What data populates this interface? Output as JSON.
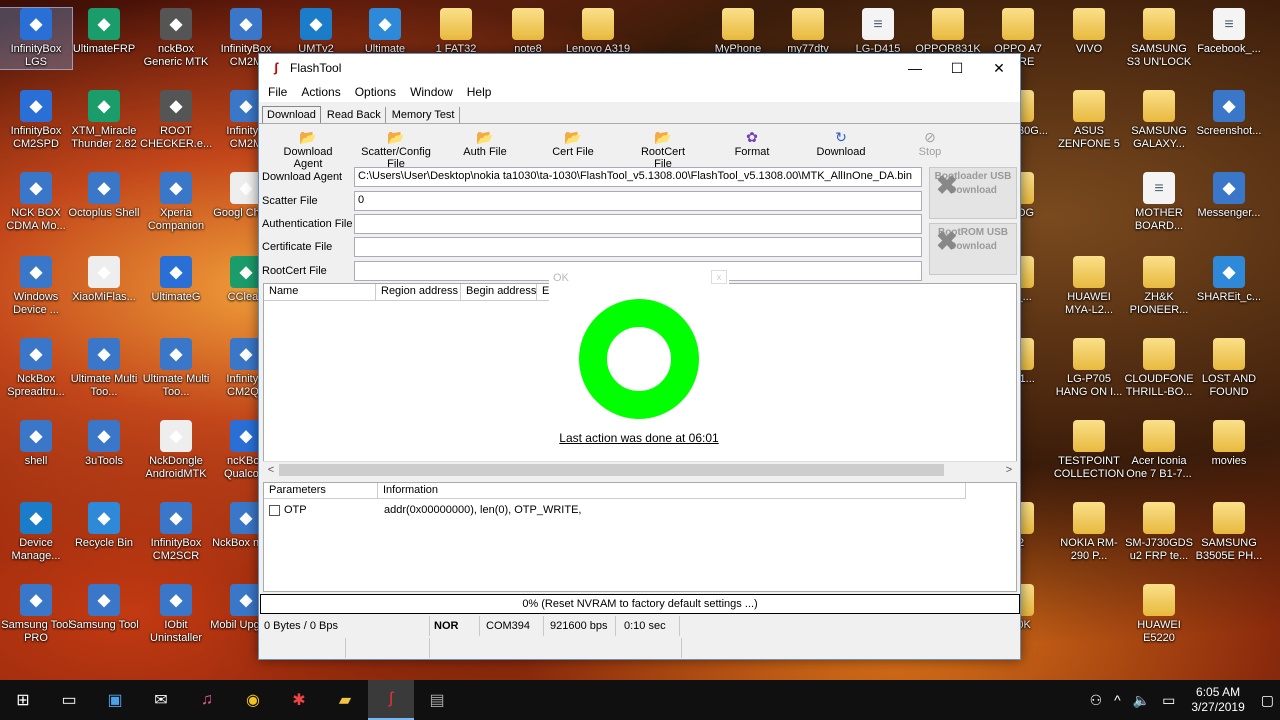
{
  "desktop": {
    "icons": [
      {
        "label": "InfinityBox LGS",
        "icon": "infinitybox-icon"
      },
      {
        "label": "UltimateFRP",
        "icon": "ultimate-frp-icon"
      },
      {
        "label": "nckBox Generic MTK",
        "icon": "nckbox-icon"
      },
      {
        "label": "InfinityBox CM2M",
        "icon": "infinitybox-icon"
      },
      {
        "label": "UMTv2",
        "icon": "umt-icon"
      },
      {
        "label": "Ultimate",
        "icon": "ultimate-icon"
      },
      {
        "label": "1 FAT32",
        "icon": "folder-icon"
      },
      {
        "label": "note8",
        "icon": "folder-icon"
      },
      {
        "label": "Lenovo A319",
        "icon": "folder-icon"
      },
      {
        "label": "MyPhone",
        "icon": "folder-icon"
      },
      {
        "label": "my77dtv",
        "icon": "folder-icon"
      },
      {
        "label": "LG-D415",
        "icon": "file-icon"
      },
      {
        "label": "OPPOR831K",
        "icon": "folder-icon"
      },
      {
        "label": "OPPO A7 WARE",
        "icon": "folder-icon"
      },
      {
        "label": "VIVO",
        "icon": "folder-icon"
      },
      {
        "label": "SAMSUNG S3 UN'LOCK",
        "icon": "folder-icon"
      },
      {
        "label": "Facebook_...",
        "icon": "file-icon"
      },
      {
        "label": "InfinityBox CM2SPD",
        "icon": "infinitybox-icon"
      },
      {
        "label": "XTM_Miracle Thunder 2.82",
        "icon": "miracle-icon"
      },
      {
        "label": "ROOT CHECKER.e...",
        "icon": "root-checker-icon"
      },
      {
        "label": "InfinityB CM2M",
        "icon": "infinitybox-icon"
      },
      {
        "label": "ng J7 30G...",
        "icon": "folder-icon"
      },
      {
        "label": "ASUS ZENFONE 5",
        "icon": "folder-icon"
      },
      {
        "label": "SAMSUNG GALAXY...",
        "icon": "folder-icon"
      },
      {
        "label": "Screenshot...",
        "icon": "image-icon"
      },
      {
        "label": "NCK BOX CDMA Mo...",
        "icon": "nckbox-icon"
      },
      {
        "label": "Octoplus Shell",
        "icon": "octoplus-icon"
      },
      {
        "label": "Xperia Companion",
        "icon": "xperia-icon"
      },
      {
        "label": "Googl Chrom",
        "icon": "chrome-icon"
      },
      {
        "label": "TOOG",
        "icon": "folder-icon"
      },
      {
        "label": "MOTHER BOARD...",
        "icon": "file-icon"
      },
      {
        "label": "Messenger...",
        "icon": "messenger-icon"
      },
      {
        "label": "Windows Device ...",
        "icon": "windows-device-icon"
      },
      {
        "label": "XiaoMiFlas...",
        "icon": "xiaomi-icon"
      },
      {
        "label": "UltimateG",
        "icon": "ultimate-icon"
      },
      {
        "label": "CClean",
        "icon": "ccleaner-icon"
      },
      {
        "label": "00_...",
        "icon": "folder-icon"
      },
      {
        "label": "HUAWEI MYA-L2...",
        "icon": "folder-icon"
      },
      {
        "label": "ZH&K PIONEER...",
        "icon": "folder-icon"
      },
      {
        "label": "SHAREit_c...",
        "icon": "shareit-icon"
      },
      {
        "label": "NckBox Spreadtru...",
        "icon": "nckbox-icon"
      },
      {
        "label": "Ultimate Multi Too...",
        "icon": "ultimate-icon"
      },
      {
        "label": "Ultimate Multi Too...",
        "icon": "ultimate-icon"
      },
      {
        "label": "InfinityB CM2QL",
        "icon": "infinitybox-icon"
      },
      {
        "label": "05_1...",
        "icon": "folder-icon"
      },
      {
        "label": "LG-P705 HANG ON I...",
        "icon": "folder-icon"
      },
      {
        "label": "CLOUDFONE THRILL-BO...",
        "icon": "folder-icon"
      },
      {
        "label": "LOST AND FOUND",
        "icon": "folder-icon"
      },
      {
        "label": "shell",
        "icon": "shell-icon"
      },
      {
        "label": "3uTools",
        "icon": "3utools-icon"
      },
      {
        "label": "NckDongle AndroidMTK",
        "icon": "nckdongle-icon"
      },
      {
        "label": "ncKBox Qualcom",
        "icon": "nckbox-icon"
      },
      {
        "label": "TESTPOINT COLLECTION",
        "icon": "folder-icon"
      },
      {
        "label": "Acer Iconia One 7 B1-7...",
        "icon": "folder-icon"
      },
      {
        "label": "movies",
        "icon": "folder-icon"
      },
      {
        "label": "Device Manage...",
        "icon": "device-manager-icon"
      },
      {
        "label": "Recycle Bin",
        "icon": "recycle-bin-icon"
      },
      {
        "label": "InfinityBox CM2SCR",
        "icon": "infinitybox-icon"
      },
      {
        "label": "NckBox n exe",
        "icon": "nckbox-icon"
      },
      {
        "label": "12",
        "icon": "folder-icon"
      },
      {
        "label": "NOKIA RM-290 P...",
        "icon": "folder-icon"
      },
      {
        "label": "SM-J730GDS u2 FRP te...",
        "icon": "folder-icon"
      },
      {
        "label": "SAMSUNG B3505E PH...",
        "icon": "folder-icon"
      },
      {
        "label": "Samsung Tool PRO",
        "icon": "samsung-tool-icon"
      },
      {
        "label": "Samsung Tool",
        "icon": "samsung-tool-icon"
      },
      {
        "label": "IObit Uninstaller",
        "icon": "iobit-icon"
      },
      {
        "label": "Mobil Upgrade",
        "icon": "mobile-upgrade-icon"
      },
      {
        "label": "580K",
        "icon": "folder-icon"
      },
      {
        "label": "HUAWEI E5220",
        "icon": "folder-icon"
      }
    ]
  },
  "window": {
    "title": "FlashTool",
    "minimize": "—",
    "maximize": "☐",
    "close": "✕"
  },
  "menu": [
    "File",
    "Actions",
    "Options",
    "Window",
    "Help"
  ],
  "tabs": [
    "Download",
    "Read Back",
    "Memory Test"
  ],
  "toolbar": [
    {
      "label": "Download Agent",
      "icon": "folder-open-icon"
    },
    {
      "label": "Scatter/Config File",
      "icon": "folder-open-icon"
    },
    {
      "label": "Auth File",
      "icon": "folder-open-icon"
    },
    {
      "label": "Cert File",
      "icon": "folder-open-icon"
    },
    {
      "label": "RootCert File",
      "icon": "folder-open-icon"
    },
    {
      "label": "Format",
      "icon": "format-icon"
    },
    {
      "label": "Download",
      "icon": "download-icon"
    },
    {
      "label": "Stop",
      "icon": "stop-icon"
    }
  ],
  "fields": [
    {
      "label": "Download Agent",
      "value": "C:\\Users\\User\\Desktop\\nokia ta1030\\ta-1030\\FlashTool_v5.1308.00\\FlashTool_v5.1308.00\\MTK_AllInOne_DA.bin"
    },
    {
      "label": "Scatter File",
      "value": "0"
    },
    {
      "label": "Authentication File",
      "value": ""
    },
    {
      "label": "Certificate File",
      "value": ""
    },
    {
      "label": "RootCert File",
      "value": ""
    }
  ],
  "side_buttons": [
    {
      "label": "Bootloader USB Download"
    },
    {
      "label": "BootROM USB Download"
    }
  ],
  "region_table": {
    "columns": [
      "Name",
      "Region address",
      "Begin address",
      "E"
    ]
  },
  "popup": {
    "title": "OK",
    "close": "x",
    "status_color": "#00ff00",
    "message": "Last action was done at 06:01"
  },
  "params_table": {
    "columns": [
      "Parameters",
      "Information"
    ],
    "rows": [
      {
        "param": "OTP",
        "info": "addr(0x00000000), len(0), OTP_WRITE,"
      }
    ]
  },
  "progress_text": "0% (Reset NVRAM to factory default settings ...)",
  "status": {
    "transfer": "0 Bytes / 0 Bps",
    "storage": "NOR",
    "port": "COM394",
    "baud": "921600 bps",
    "time": "0:10 sec"
  },
  "taskbar": {
    "time": "6:05 AM",
    "date": "3/27/2019"
  }
}
